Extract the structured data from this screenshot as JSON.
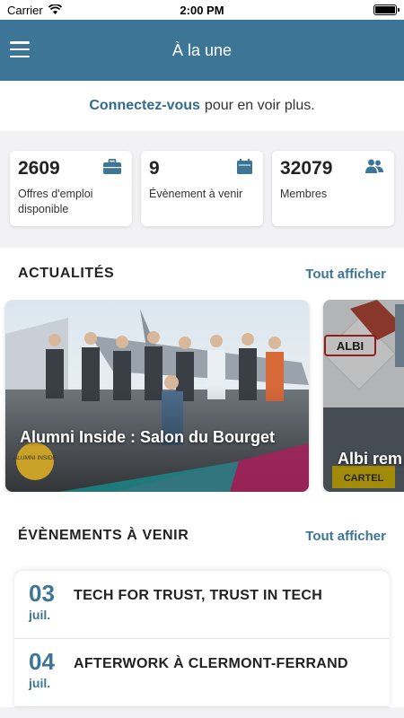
{
  "status_bar": {
    "carrier": "Carrier",
    "time": "2:00 PM"
  },
  "navbar": {
    "title": "À la une"
  },
  "login": {
    "link": "Connectez-vous",
    "rest": "pour en voir plus."
  },
  "stats": [
    {
      "value": "2609",
      "label": "Offres d'emploi disponible",
      "icon": "briefcase-icon"
    },
    {
      "value": "9",
      "label": "Évènement à venir",
      "icon": "calendar-icon"
    },
    {
      "value": "32079",
      "label": "Membres",
      "icon": "users-icon"
    }
  ],
  "news": {
    "title": "ACTUALITÉS",
    "see_all": "Tout afficher",
    "items": [
      {
        "title": "Alumni Inside : Salon du Bourget",
        "badge": "ALUMNI INSIDE"
      },
      {
        "title": "Albi rem… Cartel",
        "sign": "ALBI",
        "badge": "CARTEL"
      }
    ]
  },
  "events": {
    "title": "ÉVÈNEMENTS À VENIR",
    "see_all": "Tout afficher",
    "items": [
      {
        "day": "03",
        "month": "juil.",
        "title": "TECH FOR TRUST, TRUST IN TECH"
      },
      {
        "day": "04",
        "month": "juil.",
        "title": "AFTERWORK À CLERMONT-FERRAND"
      }
    ]
  },
  "colors": {
    "primary": "#3d7596",
    "link": "#336b8c",
    "background": "#f2f2f4"
  }
}
